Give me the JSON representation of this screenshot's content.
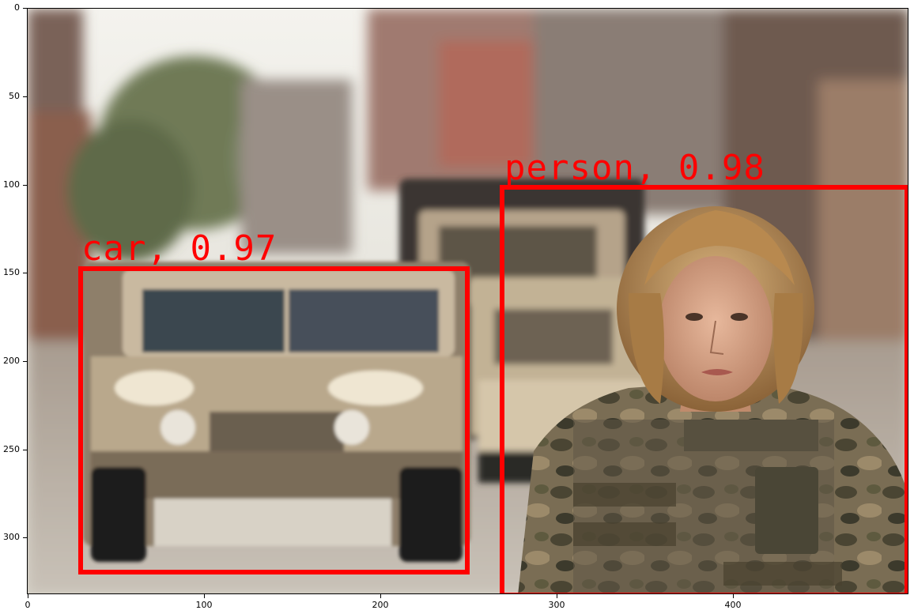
{
  "axes": {
    "yticks": [
      "0",
      "50",
      "100",
      "150",
      "200",
      "250",
      "300"
    ],
    "xticks": [
      "0",
      "100",
      "200",
      "300",
      "400"
    ]
  },
  "detections": [
    {
      "label": "car, 0.97",
      "color": "#ff0000"
    },
    {
      "label": "person, 0.98",
      "color": "#ff0000"
    }
  ]
}
